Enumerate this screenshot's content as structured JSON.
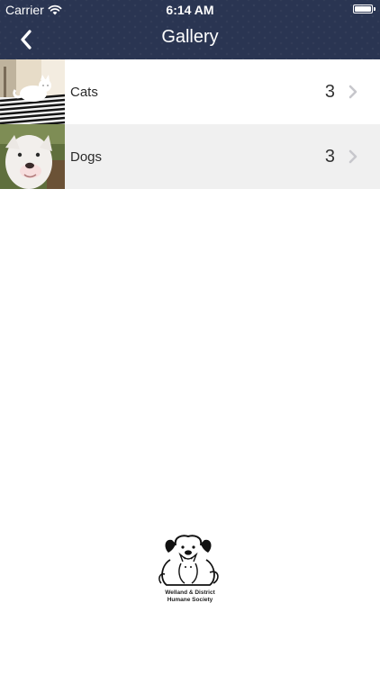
{
  "status_bar": {
    "carrier": "Carrier",
    "time": "6:14 AM",
    "battery_level": 1.0
  },
  "nav": {
    "title": "Gallery",
    "back_icon": "chevron-left-icon"
  },
  "gallery": {
    "items": [
      {
        "label": "Cats",
        "count": "3",
        "thumbnail": "white cat on zebra-striped blanket",
        "icon": "chevron-right-icon"
      },
      {
        "label": "Dogs",
        "count": "3",
        "thumbnail": "white dog face",
        "icon": "chevron-right-icon"
      }
    ]
  },
  "footer": {
    "logo_line1": "Welland & District",
    "logo_line2": "Humane Society"
  },
  "colors": {
    "navbar": "#2a3552",
    "alt_row": "#f0f0f0",
    "chevron": "#c7c7cc"
  }
}
